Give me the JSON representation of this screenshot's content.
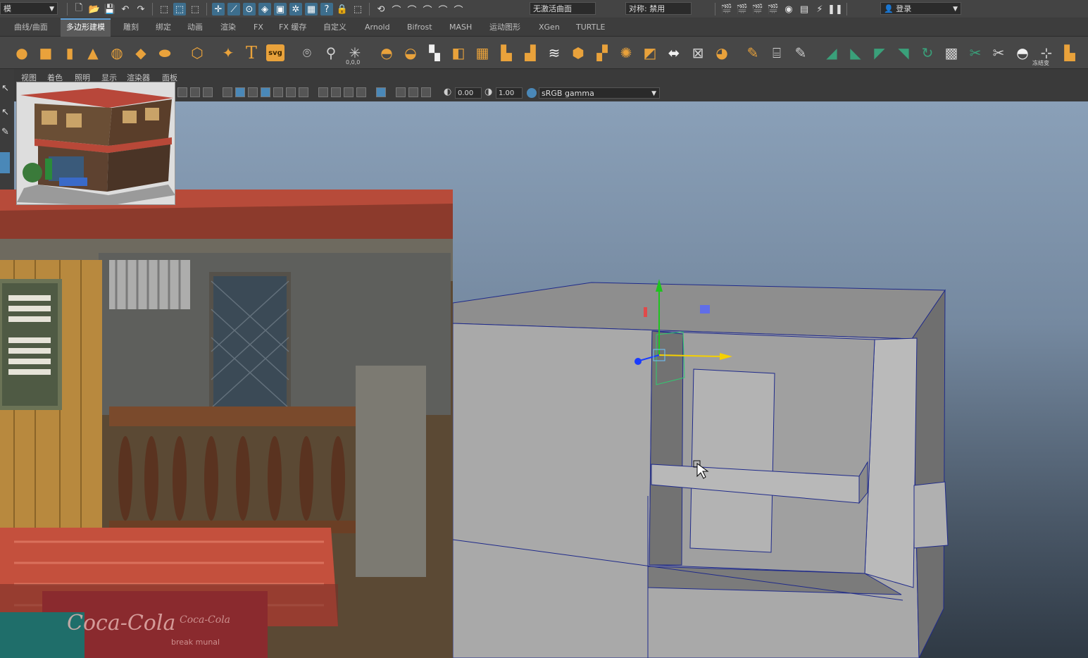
{
  "status_line": {
    "mode_menu": "模",
    "live_surface": "无激活曲面",
    "symmetry": "对称: 禁用",
    "login": "登录"
  },
  "shelf_tabs": [
    {
      "label": "曲线/曲面",
      "active": false
    },
    {
      "label": "多边形建模",
      "active": true
    },
    {
      "label": "雕刻",
      "active": false
    },
    {
      "label": "绑定",
      "active": false
    },
    {
      "label": "动画",
      "active": false
    },
    {
      "label": "渲染",
      "active": false
    },
    {
      "label": "FX",
      "active": false
    },
    {
      "label": "FX 缓存",
      "active": false
    },
    {
      "label": "自定义",
      "active": false
    },
    {
      "label": "Arnold",
      "active": false
    },
    {
      "label": "Bifrost",
      "active": false
    },
    {
      "label": "MASH",
      "active": false
    },
    {
      "label": "运动图形",
      "active": false
    },
    {
      "label": "XGen",
      "active": false
    },
    {
      "label": "TURTLE",
      "active": false
    }
  ],
  "shelf": {
    "text_tool": "T",
    "svg_tool": "svg",
    "origin_label": "0,0,0",
    "freeze_label": "冻结变"
  },
  "panel_menu": [
    "视图",
    "着色",
    "照明",
    "显示",
    "渲染器",
    "面板"
  ],
  "panel_toolbar": {
    "exposure": "0.00",
    "gamma": "1.00",
    "color_space": "sRGB gamma"
  },
  "concept_art": {
    "sign_main": "Coca-Cola",
    "sign_small": "Coca-Cola",
    "sign_tag": "break munal"
  },
  "colors": {
    "accent": "#5e9ed6",
    "shelf_orange": "#e9a23b",
    "shelf_green": "#3aa07a",
    "manip_x": "#f5d000",
    "manip_y": "#1ec41e",
    "manip_z": "#1a3cff",
    "wire": "#1f2a8a"
  }
}
